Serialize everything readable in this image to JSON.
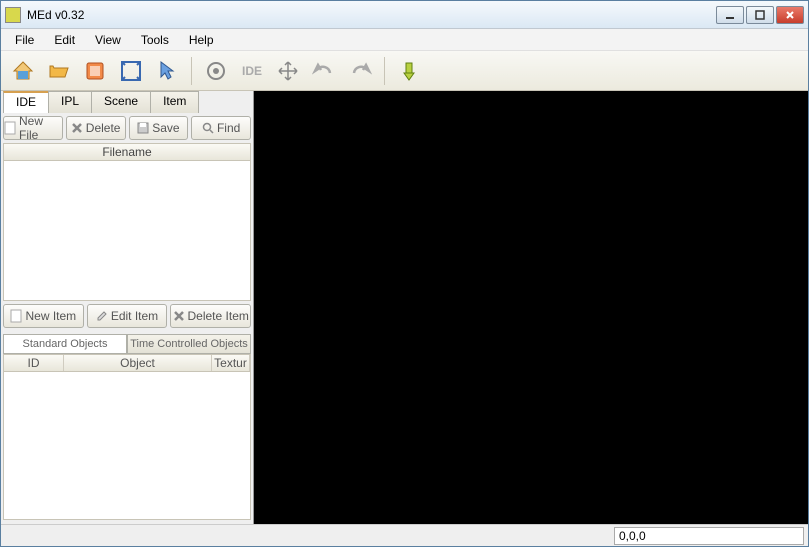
{
  "window": {
    "title": "MEd v0.32"
  },
  "menu": {
    "file": "File",
    "edit": "Edit",
    "view": "View",
    "tools": "Tools",
    "help": "Help"
  },
  "tabs": {
    "ide": "IDE",
    "ipl": "IPL",
    "scene": "Scene",
    "item": "Item"
  },
  "buttons": {
    "newfile": "New File",
    "delete": "Delete",
    "save": "Save",
    "find": "Find",
    "newitem": "New Item",
    "edititem": "Edit Item",
    "deleteitem": "Delete Item"
  },
  "list1": {
    "header": "Filename"
  },
  "subtabs": {
    "std": "Standard Objects",
    "tco": "Time Controlled Objects"
  },
  "cols": {
    "id": "ID",
    "object": "Object",
    "tex": "Textur"
  },
  "status": {
    "coords": "0,0,0"
  }
}
